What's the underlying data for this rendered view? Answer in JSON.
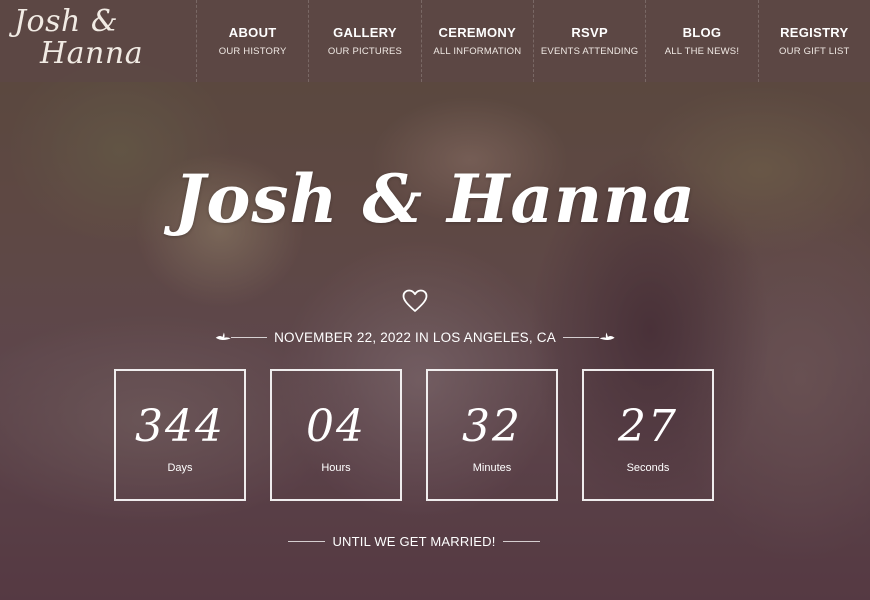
{
  "brand": {
    "line1": "Josh &",
    "line2": "Hanna"
  },
  "nav": [
    {
      "label": "ABOUT",
      "sub": "OUR HISTORY"
    },
    {
      "label": "GALLERY",
      "sub": "OUR PICTURES"
    },
    {
      "label": "CEREMONY",
      "sub": "ALL INFORMATION"
    },
    {
      "label": "RSVP",
      "sub": "EVENTS ATTENDING"
    },
    {
      "label": "BLOG",
      "sub": "ALL THE NEWS!"
    },
    {
      "label": "REGISTRY",
      "sub": "OUR GIFT LIST"
    }
  ],
  "hero": {
    "title": "Josh & Hanna",
    "heart_icon": "heart-outline-icon",
    "date_text": "NOVEMBER 22, 2022 IN LOS ANGELES, CA",
    "bird_icon": "dove-icon"
  },
  "countdown": [
    {
      "value": "344",
      "label": "Days"
    },
    {
      "value": "04",
      "label": "Hours"
    },
    {
      "value": "32",
      "label": "Minutes"
    },
    {
      "value": "27",
      "label": "Seconds"
    }
  ],
  "footer_tagline": "UNTIL WE GET MARRIED!",
  "colors": {
    "navbar": "#5c4844",
    "overlay": "#50343e",
    "text": "#ffffff"
  }
}
